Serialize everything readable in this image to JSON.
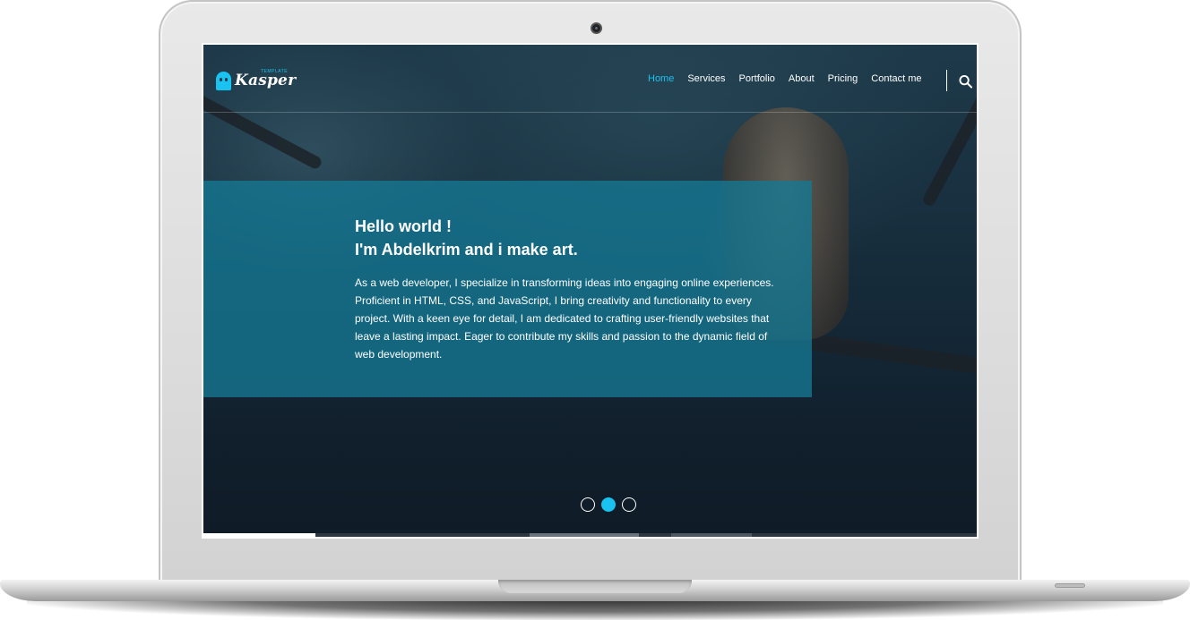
{
  "brand": {
    "name": "Kasper",
    "tagline": "TEMPLATE",
    "accent": "#19c2f0"
  },
  "nav": {
    "links": [
      "Home",
      "Services",
      "Portfolio",
      "About",
      "Pricing",
      "Contact me"
    ],
    "active_index": 0,
    "search_icon": "search-icon"
  },
  "hero": {
    "title_line1": "Hello world !",
    "title_line2": "I'm Abdelkrim and i make art.",
    "body": "As a web developer, I specialize in transforming ideas into engaging online experiences. Proficient in HTML, CSS, and JavaScript, I bring creativity and functionality to every project. With a keen eye for detail, I am dedicated to crafting user-friendly websites that leave a lasting impact. Eager to contribute my skills and passion to the dynamic field of web development."
  },
  "slider": {
    "bullet_count": 3,
    "active_bullet": 1
  },
  "progress": {
    "fraction": 0.145
  },
  "colors": {
    "hero_panel": "#14789466",
    "screen_bg": "#162c3b"
  }
}
